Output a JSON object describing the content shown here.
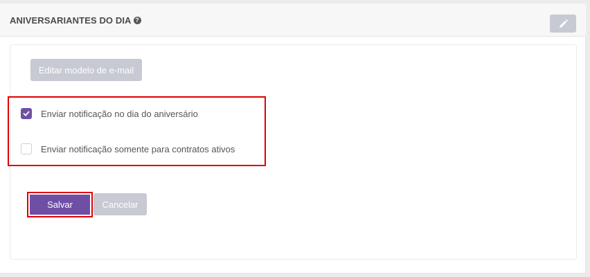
{
  "panel": {
    "title": "ANIVERSARIANTES DO DIA",
    "help_icon": "question-circle-icon",
    "edit_icon": "pencil-icon"
  },
  "actions": {
    "edit_template_label": "Editar modelo de e-mail",
    "save_label": "Salvar",
    "cancel_label": "Cancelar"
  },
  "options": [
    {
      "label": "Enviar notificação no dia do aniversário",
      "checked": true
    },
    {
      "label": "Enviar notificação somente para contratos ativos",
      "checked": false
    }
  ],
  "colors": {
    "accent": "#6f4fa6",
    "disabled_button": "#c7c9d3",
    "highlight": "#e00000"
  }
}
